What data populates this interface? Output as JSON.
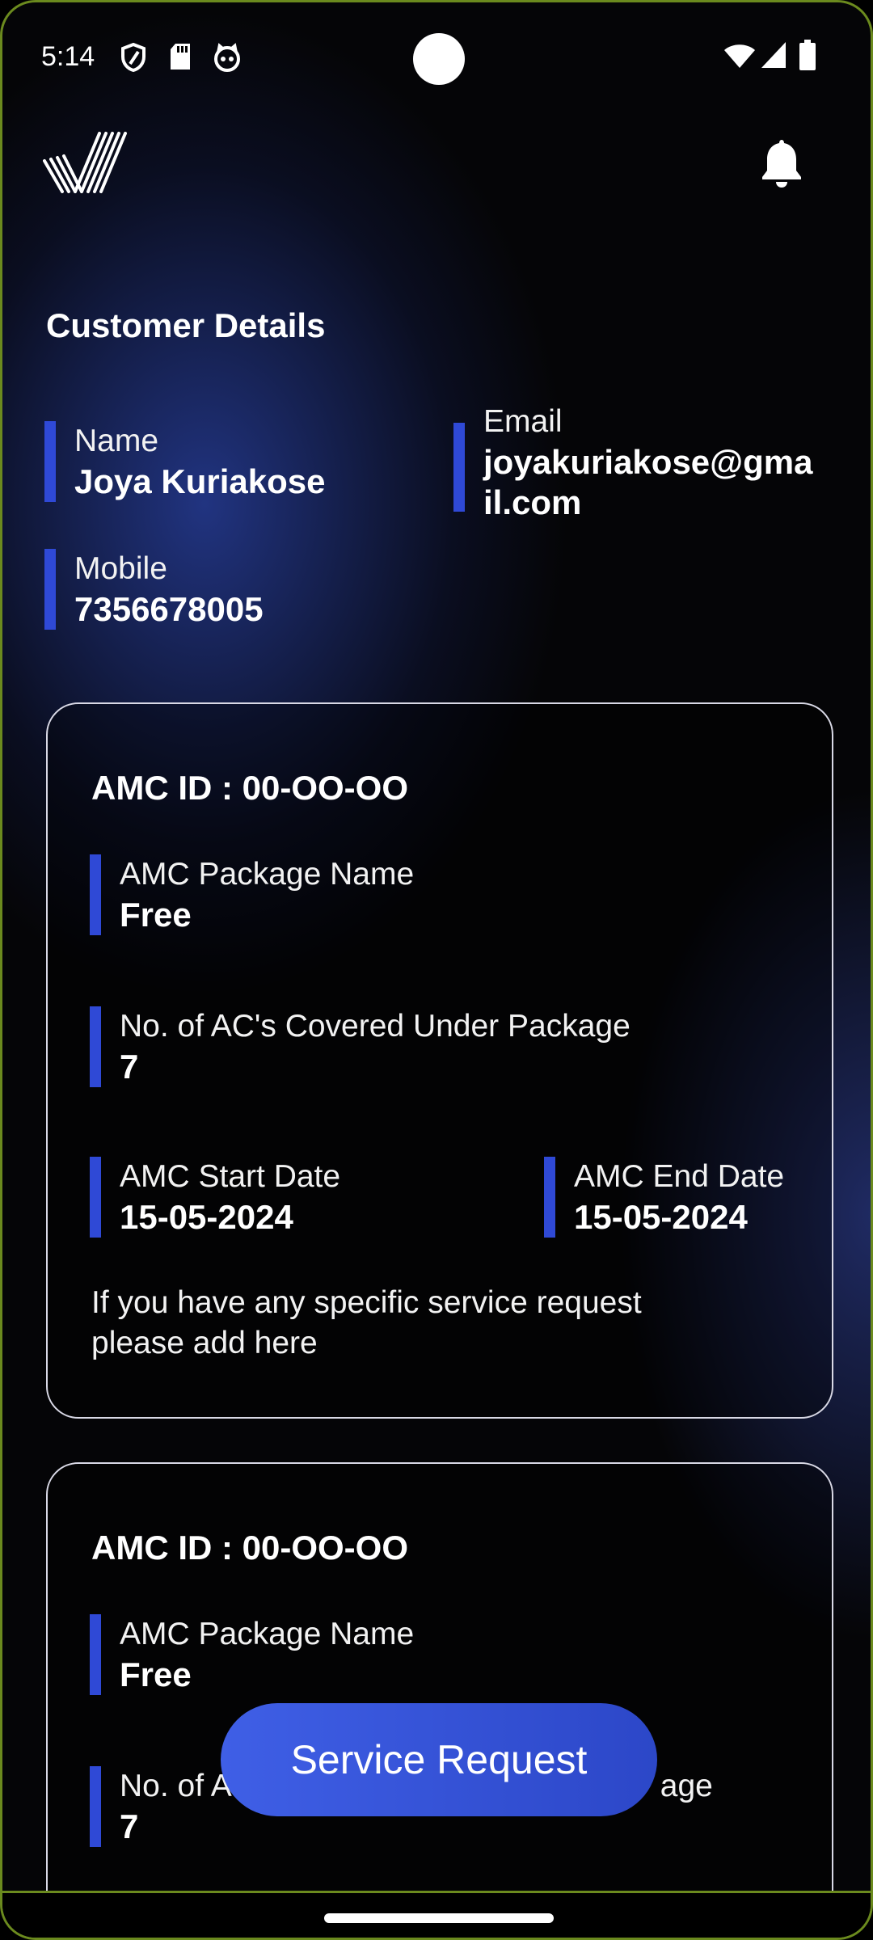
{
  "status_bar": {
    "time": "5:14",
    "left_icons": [
      "shield-icon",
      "sd-card-icon",
      "cat-face-icon"
    ],
    "right_icons": [
      "wifi-icon",
      "signal-icon",
      "battery-icon"
    ]
  },
  "header": {
    "logo": "brand-logo-stripes",
    "notification_icon": "bell-icon"
  },
  "customer": {
    "section_title": "Customer Details",
    "name_label": "Name",
    "name_value": "Joya Kuriakose",
    "email_label": "Email",
    "email_value_line1": "joyakuriakose@gma",
    "email_value_line2": "il.com",
    "mobile_label": "Mobile",
    "mobile_value": "7356678005"
  },
  "amc_cards": [
    {
      "title": "AMC ID : 00-OO-OO",
      "package_label": "AMC Package Name",
      "package_value": "Free",
      "covered_label": "No. of AC's Covered Under Package",
      "covered_value": "7",
      "start_label": "AMC Start Date",
      "start_value": "15-05-2024",
      "end_label": "AMC End Date",
      "end_value": "15-05-2024",
      "note_line1": "If you have any specific service request",
      "note_line2": "please add here"
    },
    {
      "title": "AMC ID : 00-OO-OO",
      "package_label": "AMC Package Name",
      "package_value": "Free",
      "covered_label_left": "No. of A",
      "covered_label_right": "age",
      "covered_value": "7"
    }
  ],
  "fab": {
    "label": "Service Request"
  },
  "colors": {
    "accent_bar": "#2f49d6",
    "button": "#3a55dc",
    "background": "#050507"
  }
}
